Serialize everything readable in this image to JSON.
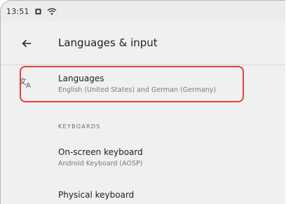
{
  "status_bar": {
    "time": "13:51",
    "icons": [
      "notification-icon",
      "wifi-icon"
    ]
  },
  "app_bar": {
    "back_icon": "back-arrow-icon",
    "title": "Languages & input"
  },
  "items": [
    {
      "title": "Languages",
      "subtitle": "English (United States) and German (Germany)",
      "icon": "translate-icon"
    }
  ],
  "section_keyboards": {
    "header": "KEYBOARDS",
    "items": [
      {
        "title": "On-screen keyboard",
        "subtitle": "Android Keyboard (AOSP)"
      },
      {
        "title": "Physical keyboard"
      }
    ]
  },
  "colors": {
    "highlight": "#e0413a",
    "background": "#f0f0f0"
  }
}
